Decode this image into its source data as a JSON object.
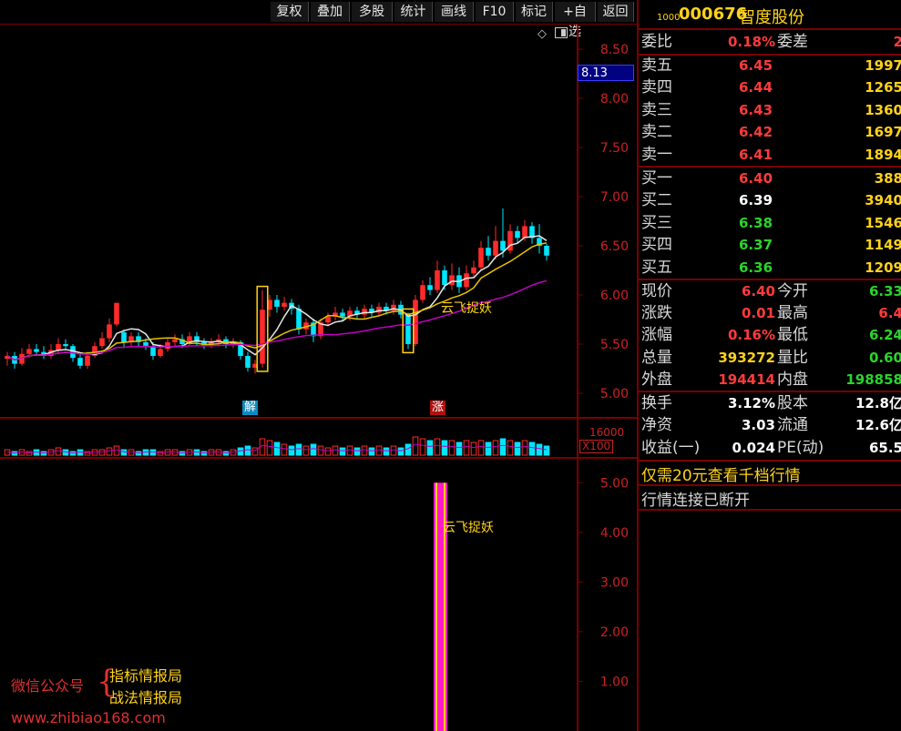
{
  "toolbar": {
    "buttons": [
      "复权",
      "叠加",
      "多股",
      "统计",
      "画线",
      "F10",
      "标记",
      "+自选",
      "返回"
    ]
  },
  "chart": {
    "current_price_tag": "8.13",
    "price_ticks": [
      "8.50",
      "8.00",
      "7.50",
      "7.00",
      "6.50",
      "6.00",
      "5.50",
      "5.00"
    ],
    "volume_top": "16000",
    "volume_unit": "X100",
    "indicator_ticks": [
      "5.00",
      "4.00",
      "3.00",
      "2.00",
      "1.00"
    ],
    "signal_jie": "解",
    "signal_zhang": "涨",
    "annotation_main": "云飞捉妖",
    "annotation_indicator": "云飞捉妖",
    "colors": {
      "up": "#ff2a2a",
      "down": "#00e5ff",
      "ma_white": "#e8e8e8",
      "ma_yellow": "#e6c200",
      "ma_purple": "#c000c0",
      "frame": "#7a0000"
    }
  },
  "chart_data": {
    "type": "candlestick",
    "candles": [
      [
        5.35,
        5.38,
        5.28,
        5.42
      ],
      [
        5.38,
        5.3,
        5.25,
        5.42
      ],
      [
        5.3,
        5.4,
        5.28,
        5.46
      ],
      [
        5.4,
        5.45,
        5.36,
        5.5
      ],
      [
        5.45,
        5.42,
        5.38,
        5.5
      ],
      [
        5.42,
        5.38,
        5.35,
        5.48
      ],
      [
        5.38,
        5.44,
        5.35,
        5.5
      ],
      [
        5.44,
        5.5,
        5.4,
        5.56
      ],
      [
        5.5,
        5.48,
        5.44,
        5.55
      ],
      [
        5.48,
        5.36,
        5.32,
        5.5
      ],
      [
        5.36,
        5.28,
        5.25,
        5.4
      ],
      [
        5.28,
        5.38,
        5.25,
        5.42
      ],
      [
        5.38,
        5.48,
        5.36,
        5.52
      ],
      [
        5.48,
        5.56,
        5.45,
        5.62
      ],
      [
        5.56,
        5.7,
        5.52,
        5.76
      ],
      [
        5.7,
        5.92,
        5.68,
        5.92
      ],
      [
        5.62,
        5.52,
        5.46,
        5.65
      ],
      [
        5.52,
        5.58,
        5.48,
        5.62
      ],
      [
        5.58,
        5.52,
        5.48,
        5.62
      ],
      [
        5.52,
        5.48,
        5.44,
        5.56
      ],
      [
        5.48,
        5.38,
        5.34,
        5.52
      ],
      [
        5.38,
        5.45,
        5.36,
        5.5
      ],
      [
        5.45,
        5.52,
        5.42,
        5.56
      ],
      [
        5.52,
        5.55,
        5.48,
        5.6
      ],
      [
        5.55,
        5.5,
        5.46,
        5.6
      ],
      [
        5.5,
        5.58,
        5.48,
        5.62
      ],
      [
        5.58,
        5.52,
        5.48,
        5.62
      ],
      [
        5.52,
        5.48,
        5.45,
        5.56
      ],
      [
        5.48,
        5.52,
        5.46,
        5.56
      ],
      [
        5.52,
        5.55,
        5.48,
        5.6
      ],
      [
        5.55,
        5.5,
        5.46,
        5.58
      ],
      [
        5.5,
        5.52,
        5.46,
        5.56
      ],
      [
        5.52,
        5.38,
        5.34,
        5.54
      ],
      [
        5.38,
        5.26,
        5.22,
        5.42
      ],
      [
        5.26,
        5.3,
        5.2,
        5.34
      ],
      [
        5.3,
        5.85,
        5.26,
        6.05
      ],
      [
        5.85,
        5.95,
        5.78,
        6.0
      ],
      [
        5.95,
        5.88,
        5.82,
        6.0
      ],
      [
        5.88,
        5.92,
        5.84,
        5.98
      ],
      [
        5.92,
        5.86,
        5.8,
        5.96
      ],
      [
        5.86,
        5.65,
        5.6,
        5.9
      ],
      [
        5.65,
        5.72,
        5.6,
        5.76
      ],
      [
        5.72,
        5.58,
        5.52,
        5.76
      ],
      [
        5.58,
        5.72,
        5.55,
        5.76
      ],
      [
        5.72,
        5.78,
        5.68,
        5.82
      ],
      [
        5.78,
        5.82,
        5.74,
        5.88
      ],
      [
        5.82,
        5.78,
        5.74,
        5.86
      ],
      [
        5.78,
        5.84,
        5.74,
        5.88
      ],
      [
        5.84,
        5.8,
        5.76,
        5.88
      ],
      [
        5.8,
        5.86,
        5.76,
        5.9
      ],
      [
        5.86,
        5.82,
        5.78,
        5.9
      ],
      [
        5.82,
        5.88,
        5.78,
        5.92
      ],
      [
        5.88,
        5.84,
        5.8,
        5.92
      ],
      [
        5.84,
        5.9,
        5.8,
        5.95
      ],
      [
        5.9,
        5.8,
        5.76,
        5.94
      ],
      [
        5.8,
        5.5,
        5.45,
        5.82
      ],
      [
        5.5,
        5.95,
        5.48,
        6.0
      ],
      [
        5.95,
        6.1,
        5.92,
        6.15
      ],
      [
        6.1,
        6.05,
        6.0,
        6.18
      ],
      [
        6.05,
        6.25,
        6.02,
        6.35
      ],
      [
        6.25,
        6.1,
        6.05,
        6.3
      ],
      [
        6.1,
        6.2,
        6.05,
        6.32
      ],
      [
        6.2,
        6.08,
        6.02,
        6.28
      ],
      [
        6.08,
        6.22,
        6.05,
        6.3
      ],
      [
        6.22,
        6.28,
        6.18,
        6.35
      ],
      [
        6.28,
        6.48,
        6.25,
        6.55
      ],
      [
        6.48,
        6.4,
        6.35,
        6.6
      ],
      [
        6.4,
        6.55,
        6.36,
        6.7
      ],
      [
        6.55,
        6.45,
        6.38,
        6.88
      ],
      [
        6.45,
        6.65,
        6.42,
        6.72
      ],
      [
        6.65,
        6.58,
        6.52,
        6.7
      ],
      [
        6.58,
        6.7,
        6.55,
        6.76
      ],
      [
        6.7,
        6.58,
        6.52,
        6.74
      ],
      [
        6.58,
        6.5,
        6.42,
        6.72
      ],
      [
        6.5,
        6.4,
        6.35,
        6.52
      ]
    ],
    "volumes": [
      3,
      2,
      3,
      2,
      3,
      2,
      3,
      4,
      3,
      2,
      3,
      2,
      3,
      3,
      4,
      5,
      3,
      3,
      2,
      3,
      3,
      2,
      3,
      3,
      2,
      3,
      3,
      2,
      3,
      3,
      2,
      3,
      4,
      5,
      4,
      9,
      8,
      7,
      6,
      5,
      6,
      5,
      6,
      5,
      4,
      5,
      4,
      5,
      4,
      5,
      4,
      5,
      4,
      5,
      4,
      6,
      10,
      9,
      8,
      9,
      8,
      8,
      7,
      8,
      7,
      8,
      7,
      8,
      9,
      8,
      7,
      8,
      7,
      6,
      5
    ],
    "price_ylim": [
      4.75,
      8.75
    ],
    "indicator_ylim": [
      0,
      5.5
    ],
    "indicator_bar": {
      "index": 56,
      "value": 5.0
    }
  },
  "panel": {
    "code_prefix": "1000",
    "code": "000676",
    "name": "智度股份",
    "weibi_label": "委比",
    "weibi_value": "0.18%",
    "weicha_label": "委差",
    "weicha_value": "2",
    "sell": [
      {
        "label": "卖五",
        "price": "6.45",
        "vol": "1997"
      },
      {
        "label": "卖四",
        "price": "6.44",
        "vol": "1265"
      },
      {
        "label": "卖三",
        "price": "6.43",
        "vol": "1360"
      },
      {
        "label": "卖二",
        "price": "6.42",
        "vol": "1697"
      },
      {
        "label": "卖一",
        "price": "6.41",
        "vol": "1894"
      }
    ],
    "buy": [
      {
        "label": "买一",
        "price": "6.40",
        "vol": "388"
      },
      {
        "label": "买二",
        "price": "6.39",
        "vol": "3940"
      },
      {
        "label": "买三",
        "price": "6.38",
        "vol": "1546"
      },
      {
        "label": "买四",
        "price": "6.37",
        "vol": "1149"
      },
      {
        "label": "买五",
        "price": "6.36",
        "vol": "1209"
      }
    ],
    "stats": [
      {
        "l1": "现价",
        "v1": "6.40",
        "c1": "red",
        "l2": "今开",
        "v2": "6.33",
        "c2": "green"
      },
      {
        "l1": "涨跌",
        "v1": "0.01",
        "c1": "red",
        "l2": "最高",
        "v2": "6.4",
        "c2": "red"
      },
      {
        "l1": "涨幅",
        "v1": "0.16%",
        "c1": "red",
        "l2": "最低",
        "v2": "6.24",
        "c2": "green"
      },
      {
        "l1": "总量",
        "v1": "393272",
        "c1": "yellow",
        "l2": "量比",
        "v2": "0.60",
        "c2": "green"
      },
      {
        "l1": "外盘",
        "v1": "194414",
        "c1": "red",
        "l2": "内盘",
        "v2": "198858",
        "c2": "green"
      }
    ],
    "fin": [
      {
        "l1": "换手",
        "v1": "3.12%",
        "l2": "股本",
        "v2": "12.8亿"
      },
      {
        "l1": "净资",
        "v1": "3.03",
        "l2": "流通",
        "v2": "12.6亿"
      },
      {
        "l1": "收益(一)",
        "v1": "0.024",
        "l2": "PE(动)",
        "v2": "65.5"
      }
    ],
    "banner1": "仅需20元查看千档行情",
    "banner2": "行情连接已断开"
  },
  "watermark": {
    "wechat": "微信公众号",
    "line1": "指标情报局",
    "line2": "战法情报局",
    "url": "www.zhibiao168.com"
  }
}
